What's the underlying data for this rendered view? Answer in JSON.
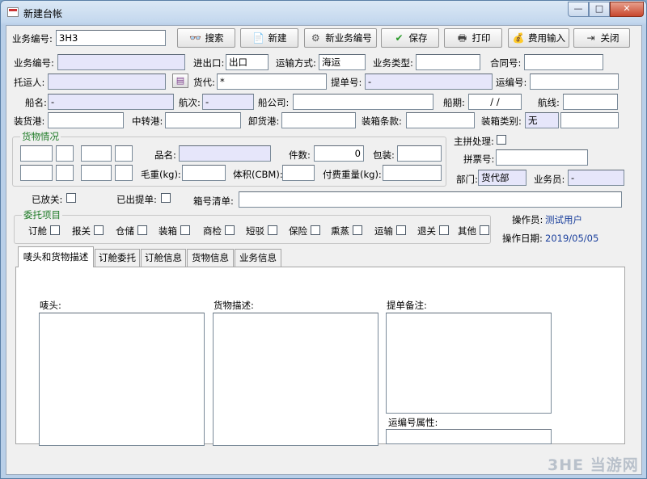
{
  "window": {
    "title": "新建台帐",
    "min_glyph": "—",
    "max_glyph": "□",
    "close_glyph": "✕"
  },
  "toolbar": {
    "biz_no_label": "业务编号:",
    "biz_no_value": "3H3",
    "search": "搜索",
    "new": "新建",
    "new_biz_no": "新业务编号",
    "save": "保存",
    "print": "打印",
    "fee_input": "费用输入",
    "close": "关闭"
  },
  "form": {
    "biz_no": {
      "label": "业务编号:",
      "value": ""
    },
    "import_export": {
      "label": "进出口:",
      "value": "出口"
    },
    "transport": {
      "label": "运输方式:",
      "value": "海运"
    },
    "biz_type": {
      "label": "业务类型:",
      "value": ""
    },
    "contract_no": {
      "label": "合同号:",
      "value": ""
    },
    "shipper": {
      "label": "托运人:",
      "value": ""
    },
    "forwarder": {
      "label": "货代:",
      "value": "*"
    },
    "bl_no": {
      "label": "提单号:",
      "value": "-"
    },
    "transport_no": {
      "label": "运编号:",
      "value": ""
    },
    "vessel": {
      "label": "船名:",
      "value": "-"
    },
    "voyage": {
      "label": "航次:",
      "value": "-"
    },
    "shipping_co": {
      "label": "船公司:",
      "value": ""
    },
    "sail_date": {
      "label": "船期:",
      "value": "/ /"
    },
    "route": {
      "label": "航线:",
      "value": ""
    },
    "loading_port": {
      "label": "装货港:",
      "value": ""
    },
    "transit_port": {
      "label": "中转港:",
      "value": ""
    },
    "discharge_port": {
      "label": "卸货港:",
      "value": ""
    },
    "packing_terms": {
      "label": "装箱条款:",
      "value": ""
    },
    "packing_type": {
      "label": "装箱类别:",
      "value": "无"
    },
    "master_consol": {
      "label": "主拼处理:"
    },
    "consol_ticket": {
      "label": "拼票号:",
      "value": ""
    },
    "dept": {
      "label": "部门:",
      "value": "货代部"
    },
    "salesman": {
      "label": "业务员:",
      "value": "-"
    },
    "released": {
      "label": "已放关:"
    },
    "bl_issued": {
      "label": "已出提单:"
    },
    "container_list": {
      "label": "箱号清单:",
      "value": ""
    }
  },
  "cargo": {
    "title": "货物情况",
    "product_name": {
      "label": "品名:",
      "value": ""
    },
    "pieces": {
      "label": "件数:",
      "value": "0"
    },
    "packing": {
      "label": "包装:",
      "value": ""
    },
    "gross_weight": {
      "label": "毛重(kg):",
      "value": ""
    },
    "volume": {
      "label": "体积(CBM):",
      "value": ""
    },
    "charge_weight": {
      "label": "付费重量(kg):",
      "value": ""
    }
  },
  "entrust": {
    "title": "委托项目",
    "items": [
      "订舱",
      "报关",
      "仓储",
      "装箱",
      "商检",
      "短驳",
      "保险",
      "熏蒸",
      "运输",
      "退关",
      "其他"
    ]
  },
  "operator": {
    "label": "操作员:",
    "value": "测试用户"
  },
  "op_date": {
    "label": "操作日期:",
    "value": "2019/05/05"
  },
  "tabs": [
    "唛头和货物描述",
    "订舱委托",
    "订舱信息",
    "货物信息",
    "业务信息"
  ],
  "tab_content": {
    "marks_label": "唛头:",
    "desc_label": "货物描述:",
    "bl_remark_label": "提单备注:",
    "transport_attr_label": "运编号属性:"
  },
  "watermark": "3HE 当游网"
}
